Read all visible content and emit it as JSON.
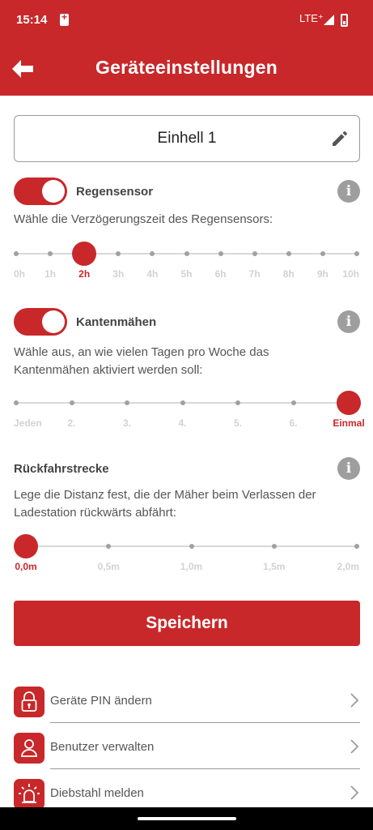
{
  "status_bar": {
    "time": "15:14",
    "network": "LTE⁺",
    "icons": [
      "sim-icon",
      "signal-icon",
      "battery-low-icon"
    ]
  },
  "app_bar": {
    "title": "Geräteeinstellungen",
    "back_icon": "arrow-left-icon"
  },
  "device_name": {
    "value": "Einhell 1",
    "edit_icon": "pencil-icon"
  },
  "rain_sensor": {
    "title": "Regensensor",
    "enabled": true,
    "description": "Wähle die Verzögerungszeit des Regensensors:",
    "ticks": [
      "0h",
      "1h",
      "2h",
      "3h",
      "4h",
      "5h",
      "6h",
      "7h",
      "8h",
      "9h",
      "10h"
    ],
    "selected_index": 2,
    "selected_value": "2h"
  },
  "edge_cut": {
    "title": "Kantenmähen",
    "enabled": true,
    "description_line1": "Wähle aus, an wie vielen Tagen pro Woche das",
    "description_line2": "Kantenmähen aktiviert werden soll:",
    "ticks": [
      "Jeden",
      "2.",
      "3.",
      "4.",
      "5.",
      "6.",
      "Einmal"
    ],
    "selected_index": 6,
    "selected_value": "Einmal"
  },
  "reverse_distance": {
    "title": "Rückfahrstrecke",
    "description_line1": "Lege die Distanz fest, die der Mäher beim Verlassen der",
    "description_line2": "Ladestation rückwärts abfährt:",
    "ticks": [
      "0,0m",
      "0,5m",
      "1,0m",
      "1,5m",
      "2,0m"
    ],
    "selected_index": 0,
    "selected_value": "0,0m"
  },
  "save_button": {
    "label": "Speichern"
  },
  "menu": [
    {
      "label": "Geräte PIN ändern",
      "icon": "lock-icon"
    },
    {
      "label": "Benutzer verwalten",
      "icon": "user-icon"
    },
    {
      "label": "Diebstahl melden",
      "icon": "alarm-light-icon"
    }
  ],
  "colors": {
    "accent": "#c8282a",
    "inactive_tick": "#d2d2d2",
    "track": "#d8d8d8",
    "info": "#9e9e9e"
  }
}
